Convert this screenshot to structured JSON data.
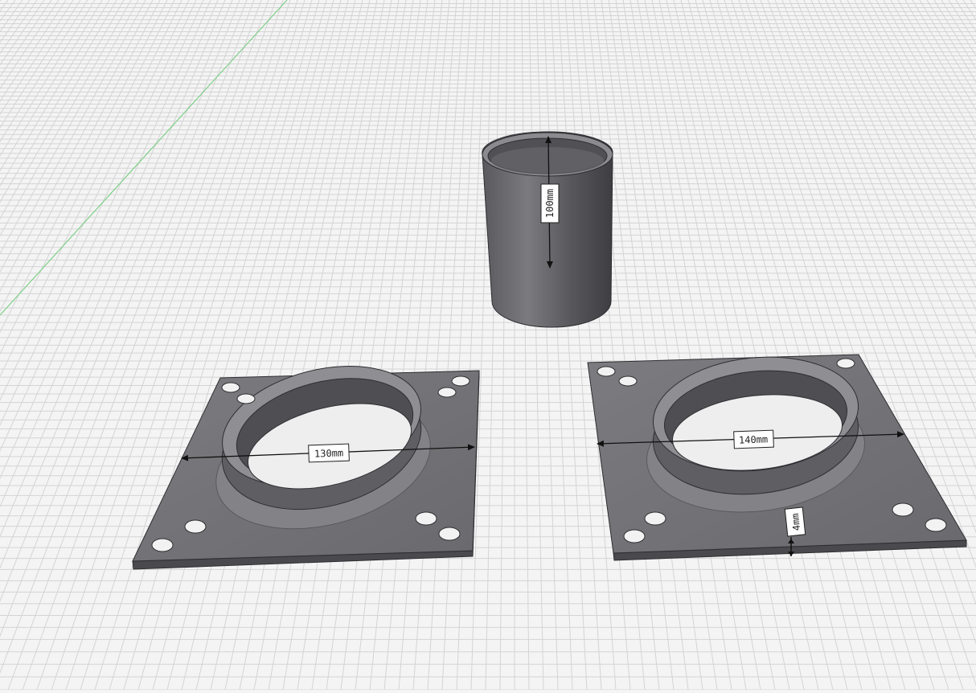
{
  "scene": {
    "dimensions": {
      "tube_height": "100mm",
      "left_flange_diameter": "130mm",
      "right_flange_diameter": "140mm",
      "plate_thickness": "4mm"
    },
    "colors": {
      "background": "#f4f4f4",
      "grid_line": "#d2d2d2",
      "axis_line": "#7fd08a",
      "model_fill": "#6e6e72",
      "model_dark": "#4a4a4e",
      "model_light": "#8d8d92",
      "label_bg": "#ffffff"
    }
  }
}
